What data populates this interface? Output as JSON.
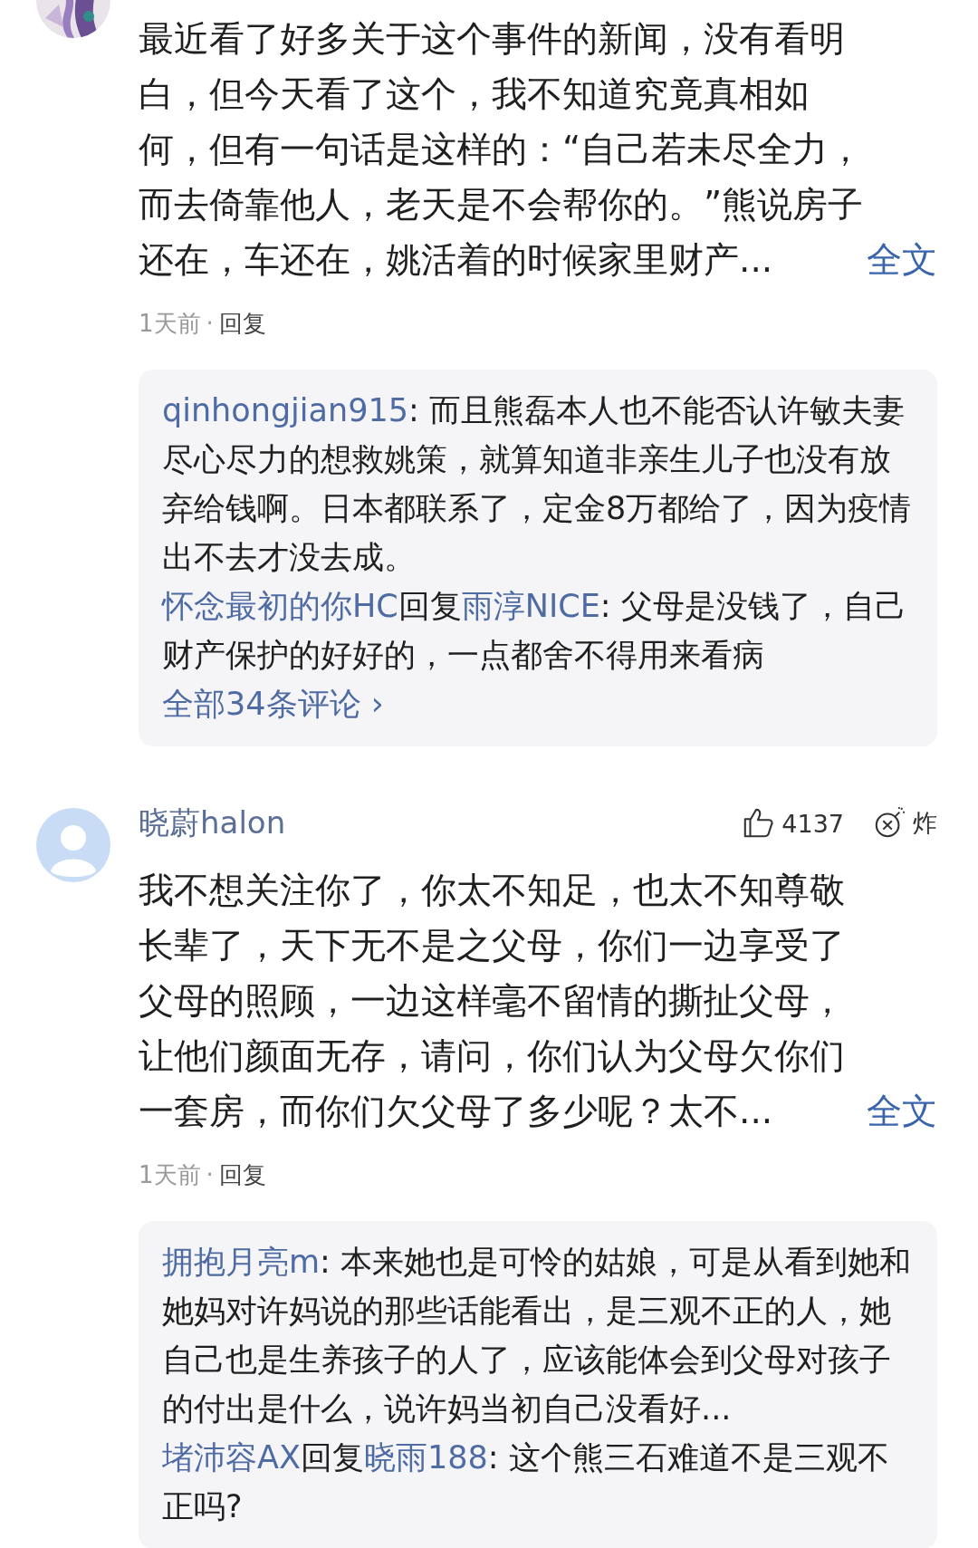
{
  "comments": [
    {
      "text": "最近看了好多关于这个事件的新闻，没有看明白，但今天看了这个，我不知道究竟真相如何，但有一句话是这样的：“自己若未尽全力，而去倚靠他人，老天是不会帮你的。”熊说房子还在，车还在，姚活着的时候家里财产...",
      "expand": "全文",
      "time": "1天前",
      "dot": "·",
      "reply_action": "回复",
      "replies": [
        {
          "author": "qinhongjian915",
          "text": ": 而且熊磊本人也不能否认许敏夫妻尽心尽力的想救姚策，就算知道非亲生儿子也没有放弃给钱啊。日本都联系了，定金8万都给了，因为疫情出不去才没去成。"
        },
        {
          "author": "怀念最初的你HC",
          "reply_word": "回复",
          "reply_to": "雨淳NICE",
          "text": ": 父母是没钱了，自己财产保护的好好的，一点都舍不得用来看病"
        }
      ],
      "view_all": "全部34条评论",
      "view_all_arrow": "›"
    },
    {
      "avatar": {
        "kind": "default"
      },
      "username": "晓蔚halon",
      "likes": "4137",
      "bomb": "炸",
      "text": "我不想关注你了，你太不知足，也太不知尊敬长辈了，天下无不是之父母，你们一边享受了父母的照顾，一边这样毫不留情的撕扯父母，让他们颜面无存，请问，你们认为父母欠你们一套房，而你们欠父母了多少呢？太不...",
      "expand": "全文",
      "time": "1天前",
      "dot": "·",
      "reply_action": "回复",
      "replies": [
        {
          "author": "拥抱月亮m",
          "text": ": 本来她也是可怜的姑娘，可是从看到她和她妈对许妈说的那些话能看出，是三观不正的人，她自己也是生养孩子的人了，应该能体会到父母对孩子的付出是什么，说许妈当初自己没看好..."
        },
        {
          "author": "堵沛容AX",
          "reply_word": "回复",
          "reply_to": "晓雨188",
          "text": ": 这个熊三石难道不是三观不正吗?"
        }
      ]
    }
  ]
}
